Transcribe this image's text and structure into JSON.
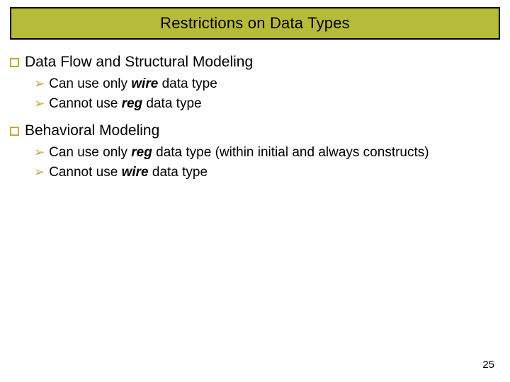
{
  "title": "Restrictions on Data Types",
  "sections": [
    {
      "heading": "Data Flow and Structural Modeling",
      "items": [
        {
          "pre": "Can use only ",
          "kw": "wire",
          "post": " data type"
        },
        {
          "pre": "Cannot use ",
          "kw": "reg",
          "post": " data type"
        }
      ]
    },
    {
      "heading": "Behavioral Modeling",
      "items": [
        {
          "pre": "Can use only ",
          "kw": "reg",
          "post": " data type (within initial and always constructs)"
        },
        {
          "pre": "Cannot use ",
          "kw": "wire",
          "post": " data type"
        }
      ]
    }
  ],
  "page_number": "25"
}
